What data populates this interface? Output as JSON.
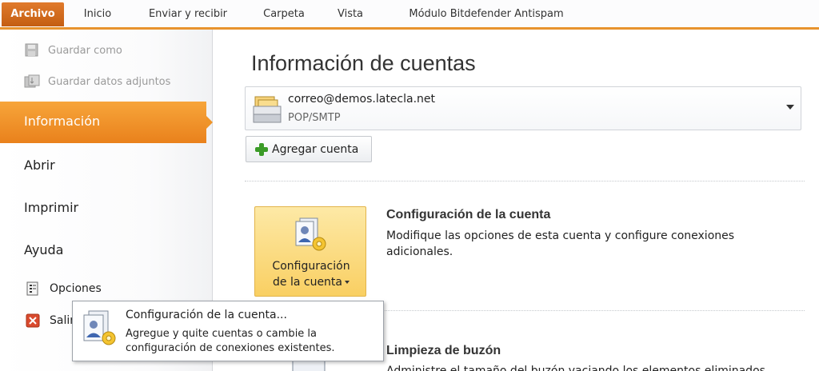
{
  "ribbon": {
    "tabs": [
      "Archivo",
      "Inicio",
      "Enviar y recibir",
      "Carpeta",
      "Vista",
      "Módulo Bitdefender Antispam"
    ]
  },
  "backstage": {
    "commands": [
      "Guardar como",
      "Guardar datos adjuntos"
    ],
    "nav_items": [
      "Información",
      "Abrir",
      "Imprimir",
      "Ayuda"
    ],
    "active_item": "Información",
    "small_commands": [
      "Opciones",
      "Salir"
    ]
  },
  "main": {
    "title": "Información de cuentas",
    "account": {
      "email": "correo@demos.latecla.net",
      "type": "POP/SMTP"
    },
    "add_account_label": "Agregar cuenta",
    "config_button_label_line1": "Configuración",
    "config_button_label_line2": "de la cuenta",
    "section1_title": "Configuración de la cuenta",
    "section1_desc_line1": "Modifique las opciones de esta cuenta y configure conexiones",
    "section1_desc_line2": "adicionales.",
    "section2_title": "Limpieza de buzón",
    "section2_desc": "Administre el tamaño del buzón vaciando los elementos eliminados"
  },
  "popup": {
    "title": "Configuración de la cuenta...",
    "desc_line1": "Agregue y quite cuentas o cambie la",
    "desc_line2": "configuración de conexiones existentes."
  },
  "colors": {
    "accent": "#e9811c",
    "button_highlight": "#f9cf62"
  }
}
